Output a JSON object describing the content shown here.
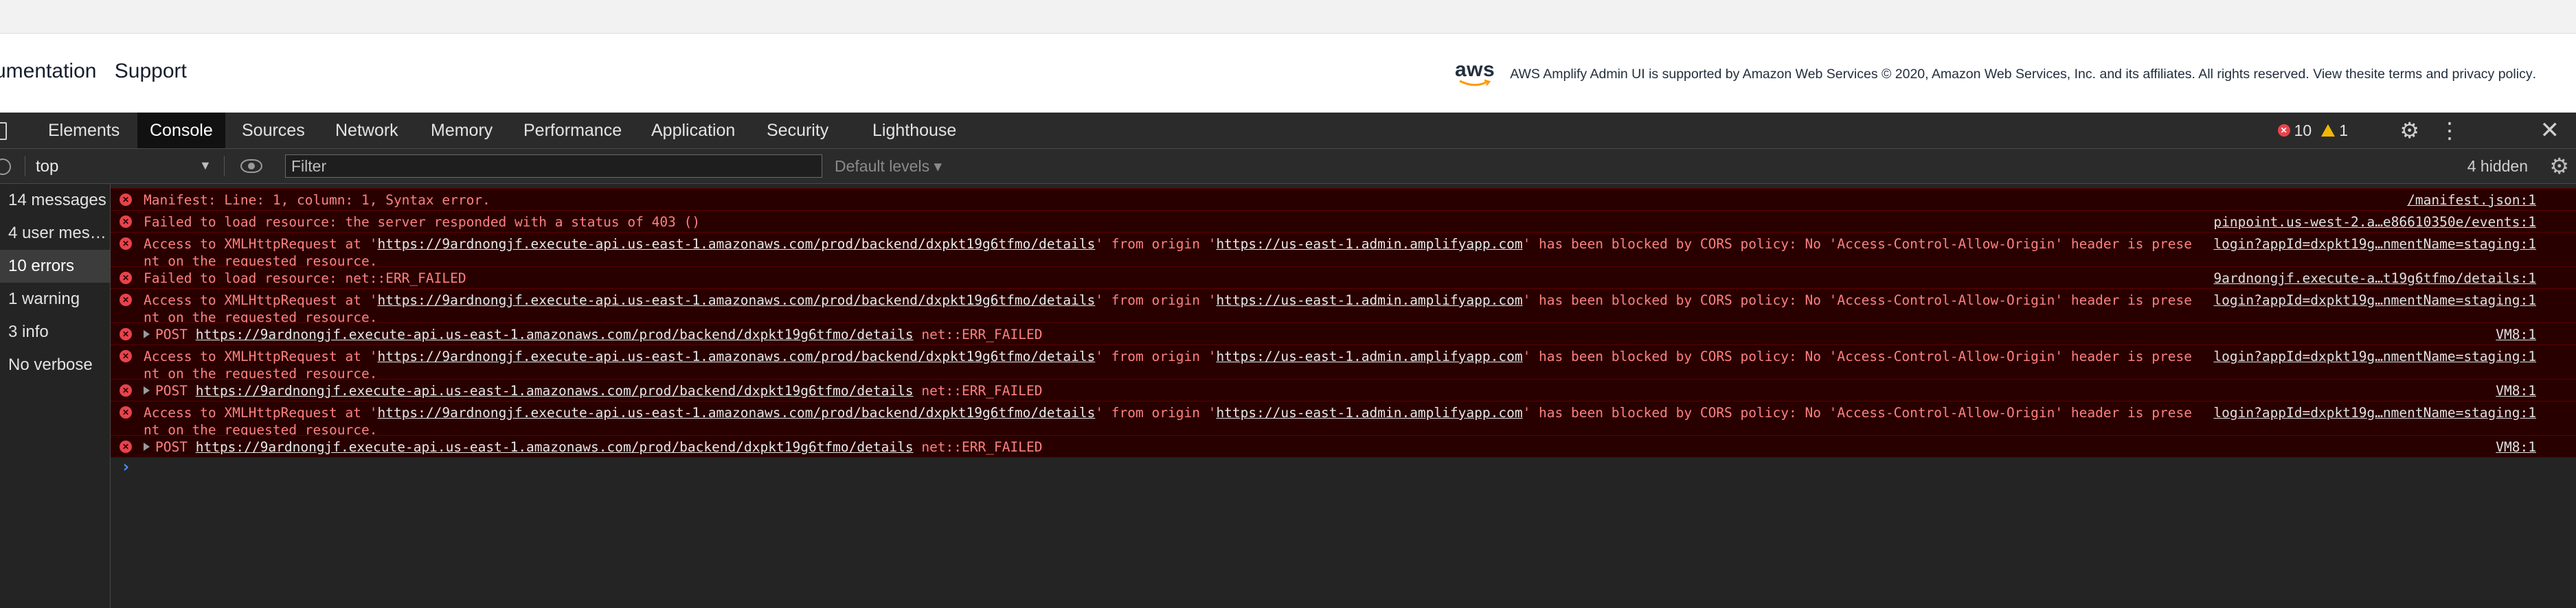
{
  "page": {
    "links": [
      "umentation",
      "Support"
    ],
    "aws_logo": "aws",
    "footer_text": "AWS Amplify Admin UI is supported by Amazon Web Services © 2020, Amazon Web Services, Inc. and its affiliates. All rights reserved. View the ",
    "footer_link1": "site terms",
    "footer_and": " and ",
    "footer_link2": "privacy policy",
    "footer_end": "."
  },
  "devtools": {
    "tabs": [
      "Elements",
      "Console",
      "Sources",
      "Network",
      "Memory",
      "Performance",
      "Application",
      "Security",
      "Lighthouse"
    ],
    "active_tab": "Console",
    "error_count": "10",
    "warning_count": "1",
    "toolbar": {
      "context": "top",
      "filter_placeholder": "Filter",
      "levels": "Default levels",
      "hidden": "4 hidden"
    },
    "sidebar": [
      "14 messages",
      "4 user mes…",
      "10 errors",
      "1 warning",
      "3 info",
      "No verbose"
    ],
    "sidebar_selected": "10 errors"
  },
  "console": {
    "messages": [
      {
        "text": "Manifest: Line: 1, column: 1, Syntax error.",
        "source": "/manifest.json:1"
      },
      {
        "text": "Failed to load resource: the server responded with a status of 403 ()",
        "source": "pinpoint.us-west-2.a…e86610350e/events:1"
      },
      {
        "pre": "Access to XMLHttpRequest at '",
        "url1": "https://9ardnongjf.execute-api.us-east-1.amazonaws.com/prod/backend/dxpkt19g6tfmo/details",
        "mid": "' from origin '",
        "url2": "https://us-east-1.admin.amplifyapp.com",
        "post": "' has been blocked by CORS policy: No 'Access-Control-Allow-Origin' header is present on the requested resource.",
        "source": "login?appId=dxpkt19g…nmentName=staging:1"
      },
      {
        "text": "Failed to load resource: net::ERR_FAILED",
        "source": "9ardnongjf.execute-a…t19g6tfmo/details:1"
      },
      {
        "pre": "Access to XMLHttpRequest at '",
        "url1": "https://9ardnongjf.execute-api.us-east-1.amazonaws.com/prod/backend/dxpkt19g6tfmo/details",
        "mid": "' from origin '",
        "url2": "https://us-east-1.admin.amplifyapp.com",
        "post": "' has been blocked by CORS policy: No 'Access-Control-Allow-Origin' header is present on the requested resource.",
        "source": "login?appId=dxpkt19g…nmentName=staging:1"
      },
      {
        "method": "POST",
        "url": "https://9ardnongjf.execute-api.us-east-1.amazonaws.com/prod/backend/dxpkt19g6tfmo/details",
        "status": "net::ERR_FAILED",
        "source": "VM8:1"
      },
      {
        "pre": "Access to XMLHttpRequest at '",
        "url1": "https://9ardnongjf.execute-api.us-east-1.amazonaws.com/prod/backend/dxpkt19g6tfmo/details",
        "mid": "' from origin '",
        "url2": "https://us-east-1.admin.amplifyapp.com",
        "post": "' has been blocked by CORS policy: No 'Access-Control-Allow-Origin' header is present on the requested resource.",
        "source": "login?appId=dxpkt19g…nmentName=staging:1"
      },
      {
        "method": "POST",
        "url": "https://9ardnongjf.execute-api.us-east-1.amazonaws.com/prod/backend/dxpkt19g6tfmo/details",
        "status": "net::ERR_FAILED",
        "source": "VM8:1"
      },
      {
        "pre": "Access to XMLHttpRequest at '",
        "url1": "https://9ardnongjf.execute-api.us-east-1.amazonaws.com/prod/backend/dxpkt19g6tfmo/details",
        "mid": "' from origin '",
        "url2": "https://us-east-1.admin.amplifyapp.com",
        "post": "' has been blocked by CORS policy: No 'Access-Control-Allow-Origin' header is present on the requested resource.",
        "source": "login?appId=dxpkt19g…nmentName=staging:1"
      },
      {
        "method": "POST",
        "url": "https://9ardnongjf.execute-api.us-east-1.amazonaws.com/prod/backend/dxpkt19g6tfmo/details",
        "status": "net::ERR_FAILED",
        "source": "VM8:1"
      }
    ],
    "prompt": "›"
  },
  "colors": {
    "error_bg": "#290000",
    "error_text": "#ff8080",
    "error_icon": "#e8434b",
    "warning_icon": "#f2b705",
    "prompt": "#4f8df5"
  }
}
